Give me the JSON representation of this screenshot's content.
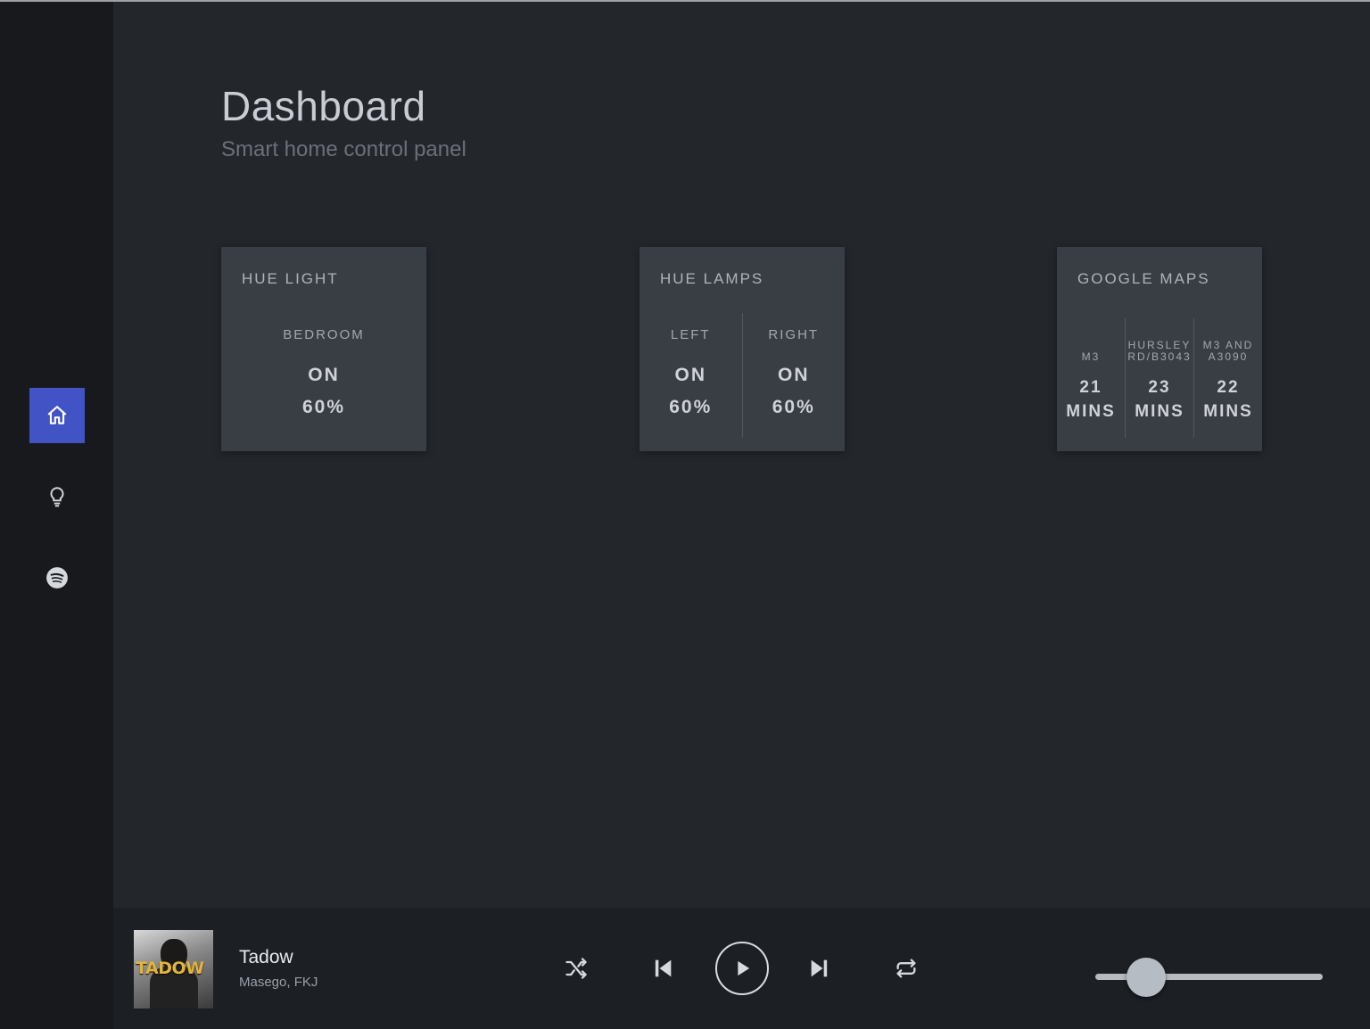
{
  "header": {
    "title": "Dashboard",
    "subtitle": "Smart home control panel"
  },
  "sidebar": {
    "items": [
      {
        "icon": "home-icon",
        "active": true
      },
      {
        "icon": "lightbulb-icon",
        "active": false
      },
      {
        "icon": "spotify-icon",
        "active": false
      }
    ]
  },
  "cards": {
    "hue_light": {
      "title": "HUE LIGHT",
      "zones": [
        {
          "label": "BEDROOM",
          "state": "ON",
          "level": "60%"
        }
      ]
    },
    "hue_lamps": {
      "title": "HUE LAMPS",
      "zones": [
        {
          "label": "LEFT",
          "state": "ON",
          "level": "60%"
        },
        {
          "label": "RIGHT",
          "state": "ON",
          "level": "60%"
        }
      ]
    },
    "google_maps": {
      "title": "GOOGLE MAPS",
      "routes": [
        {
          "label": "M3",
          "time": "21",
          "unit": "MINS"
        },
        {
          "label_line1": "HURSLEY",
          "label_line2": "RD/B3043",
          "time": "23",
          "unit": "MINS"
        },
        {
          "label_line1": "M3 AND",
          "label_line2": "A3090",
          "time": "22",
          "unit": "MINS"
        }
      ]
    }
  },
  "player": {
    "album_art_text": "TADOW",
    "track_title": "Tadow",
    "artist": "Masego, FKJ",
    "volume": 0.22,
    "controls": [
      "shuffle-icon",
      "previous-icon",
      "play-icon",
      "next-icon",
      "repeat-icon"
    ]
  },
  "colors": {
    "accent": "#4254c5",
    "background": "#23262b",
    "sidebar": "#17191c",
    "card": "#393d44"
  }
}
